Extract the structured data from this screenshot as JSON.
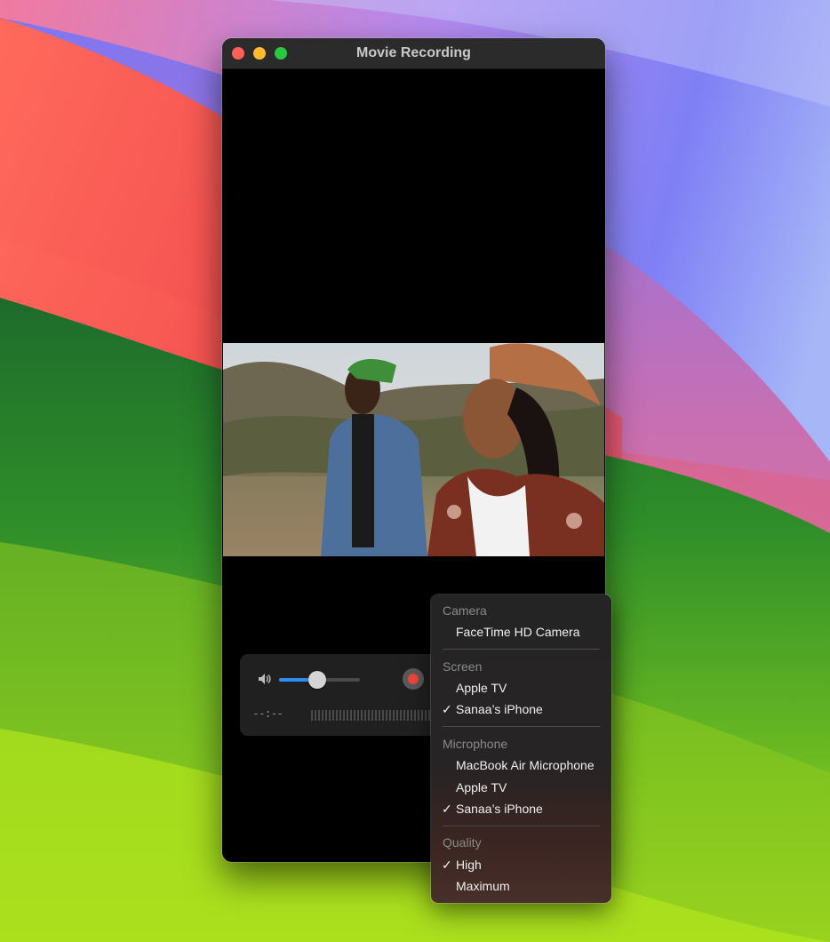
{
  "window": {
    "title": "Movie Recording"
  },
  "controls": {
    "volume_level": 0.47,
    "timer": "--:--"
  },
  "options_menu": {
    "sections": [
      {
        "header": "Camera",
        "items": [
          {
            "label": "FaceTime HD Camera",
            "checked": false
          }
        ]
      },
      {
        "header": "Screen",
        "items": [
          {
            "label": "Apple TV",
            "checked": false
          },
          {
            "label": "Sanaa’s iPhone",
            "checked": true
          }
        ]
      },
      {
        "header": "Microphone",
        "items": [
          {
            "label": "MacBook Air Microphone",
            "checked": false
          },
          {
            "label": "Apple TV",
            "checked": false
          },
          {
            "label": "Sanaa’s iPhone",
            "checked": true
          }
        ]
      },
      {
        "header": "Quality",
        "items": [
          {
            "label": "High",
            "checked": true
          },
          {
            "label": "Maximum",
            "checked": false
          }
        ]
      }
    ]
  },
  "icons": {
    "check": "✓",
    "volume": "speaker-icon",
    "record": "record-icon"
  },
  "colors": {
    "accent": "#2f8cf5",
    "record": "#f0463c",
    "close": "#fe5f57",
    "minimize": "#febc2e",
    "zoom": "#28c840"
  }
}
